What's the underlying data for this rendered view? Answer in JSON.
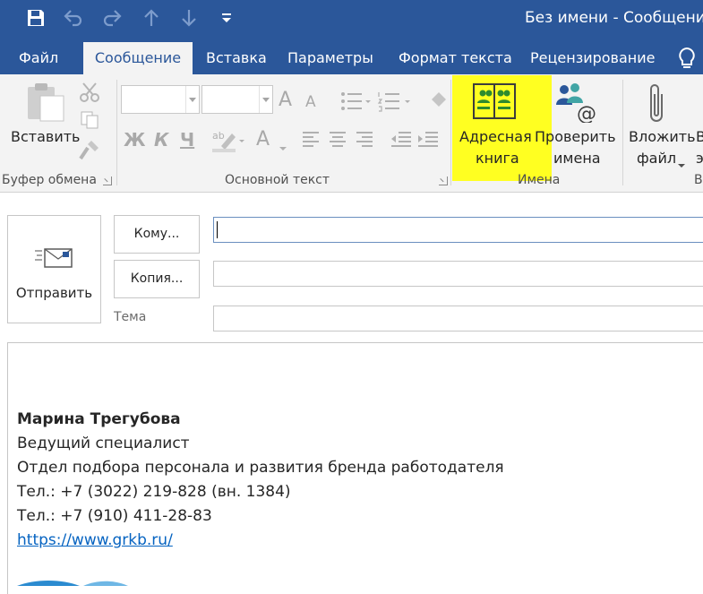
{
  "window": {
    "title": "Без имени - Сообщение"
  },
  "quick_access": [
    "save-icon",
    "undo-icon",
    "redo-icon",
    "up-icon",
    "down-icon",
    "customize-icon"
  ],
  "tabs": [
    {
      "label": "Файл"
    },
    {
      "label": "Сообщение"
    },
    {
      "label": "Вставка"
    },
    {
      "label": "Параметры"
    },
    {
      "label": "Формат текста"
    },
    {
      "label": "Рецензирование"
    }
  ],
  "ribbon": {
    "clipboard": {
      "paste_label": "Вставить",
      "group_label": "Буфер обмена"
    },
    "basic_text": {
      "bold": "Ж",
      "italic": "К",
      "underline": "Ч",
      "font_color_letter": "A",
      "grow_letter": "A",
      "shrink_letter": "A",
      "group_label": "Основной текст"
    },
    "names": {
      "address_book_line1": "Адресная",
      "address_book_line2": "книга",
      "check_names_line1": "Проверить",
      "check_names_line2": "имена",
      "group_label": "Имена"
    },
    "include": {
      "attach_line1": "Вложить",
      "attach_line2": "файл",
      "next_line1": "В",
      "next_line2": "э",
      "group_label": "В"
    }
  },
  "compose": {
    "send_label": "Отправить",
    "to_label": "Кому...",
    "cc_label": "Копия...",
    "subject_label": "Тема",
    "to_value": "",
    "cc_value": "",
    "subject_value": ""
  },
  "signature": {
    "name": "Марина Трегубова",
    "position": "Ведущий специалист",
    "department": "Отдел подбора персонала и развития бренда работодателя",
    "phone1": "Тел.: +7 (3022) 219-828 (вн. 1384)",
    "phone2": "Тел.: +7 (910) 411-28-83",
    "link": "https://www.grkb.ru/"
  },
  "colors": {
    "accent": "#2b579a",
    "highlight": "#ffff21",
    "link": "#0563c1",
    "ribbon_bg": "#f3f3f3"
  }
}
